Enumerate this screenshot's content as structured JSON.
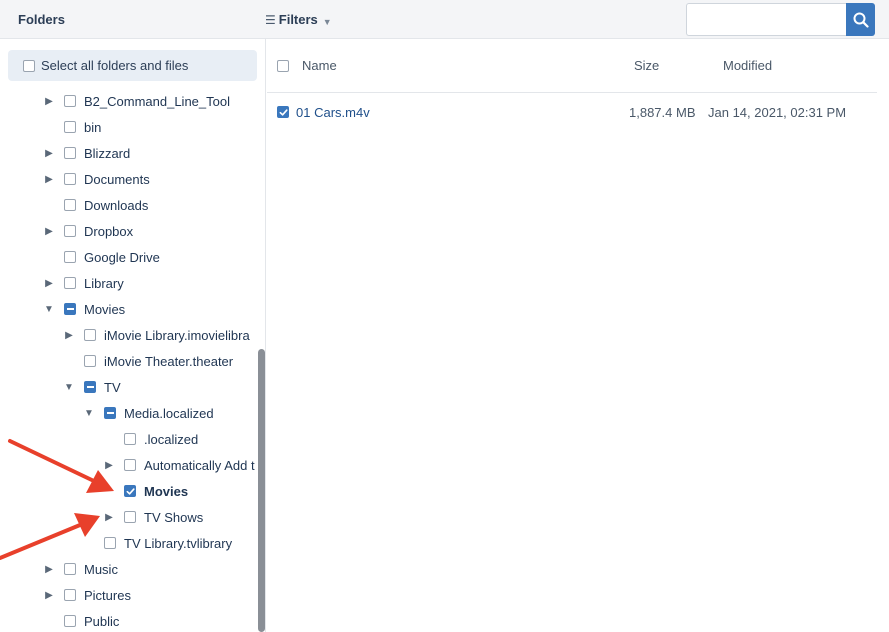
{
  "header": {
    "folders_title": "Folders",
    "filters_label": "Filters",
    "search_placeholder": ""
  },
  "select_all": {
    "label": "Select all folders and files",
    "checked": false
  },
  "tree": [
    {
      "label": "B2_Command_Line_Tool",
      "level": 0,
      "expandable": true,
      "expanded": false,
      "state": "unchecked"
    },
    {
      "label": "bin",
      "level": 0,
      "expandable": false,
      "expanded": false,
      "state": "unchecked"
    },
    {
      "label": "Blizzard",
      "level": 0,
      "expandable": true,
      "expanded": false,
      "state": "unchecked"
    },
    {
      "label": "Documents",
      "level": 0,
      "expandable": true,
      "expanded": false,
      "state": "unchecked"
    },
    {
      "label": "Downloads",
      "level": 0,
      "expandable": false,
      "expanded": false,
      "state": "unchecked"
    },
    {
      "label": "Dropbox",
      "level": 0,
      "expandable": true,
      "expanded": false,
      "state": "unchecked"
    },
    {
      "label": "Google Drive",
      "level": 0,
      "expandable": false,
      "expanded": false,
      "state": "unchecked"
    },
    {
      "label": "Library",
      "level": 0,
      "expandable": true,
      "expanded": false,
      "state": "unchecked"
    },
    {
      "label": "Movies",
      "level": 0,
      "expandable": true,
      "expanded": true,
      "state": "indeterminate"
    },
    {
      "label": "iMovie Library.imovielibra",
      "level": 1,
      "expandable": true,
      "expanded": false,
      "state": "unchecked"
    },
    {
      "label": "iMovie Theater.theater",
      "level": 1,
      "expandable": false,
      "expanded": false,
      "state": "unchecked"
    },
    {
      "label": "TV",
      "level": 1,
      "expandable": true,
      "expanded": true,
      "state": "indeterminate"
    },
    {
      "label": "Media.localized",
      "level": 2,
      "expandable": true,
      "expanded": true,
      "state": "indeterminate"
    },
    {
      "label": ".localized",
      "level": 3,
      "expandable": false,
      "expanded": false,
      "state": "unchecked"
    },
    {
      "label": "Automatically Add t",
      "level": 3,
      "expandable": true,
      "expanded": false,
      "state": "unchecked"
    },
    {
      "label": "Movies",
      "level": 3,
      "expandable": false,
      "expanded": false,
      "state": "checked",
      "bold": true
    },
    {
      "label": "TV Shows",
      "level": 3,
      "expandable": true,
      "expanded": false,
      "state": "unchecked"
    },
    {
      "label": "TV Library.tvlibrary",
      "level": 2,
      "expandable": false,
      "expanded": false,
      "state": "unchecked"
    },
    {
      "label": "Music",
      "level": 0,
      "expandable": true,
      "expanded": false,
      "state": "unchecked"
    },
    {
      "label": "Pictures",
      "level": 0,
      "expandable": true,
      "expanded": false,
      "state": "unchecked"
    },
    {
      "label": "Public",
      "level": 0,
      "expandable": false,
      "expanded": false,
      "state": "unchecked"
    }
  ],
  "files": {
    "columns": {
      "name": "Name",
      "size": "Size",
      "modified": "Modified"
    },
    "rows": [
      {
        "name": "01 Cars.m4v",
        "size": "1,887.4 MB",
        "modified": "Jan 14, 2021, 02:31 PM",
        "checked": true
      }
    ]
  },
  "colors": {
    "accent": "#3a77bd",
    "annotation_arrow": "#e8402b"
  }
}
